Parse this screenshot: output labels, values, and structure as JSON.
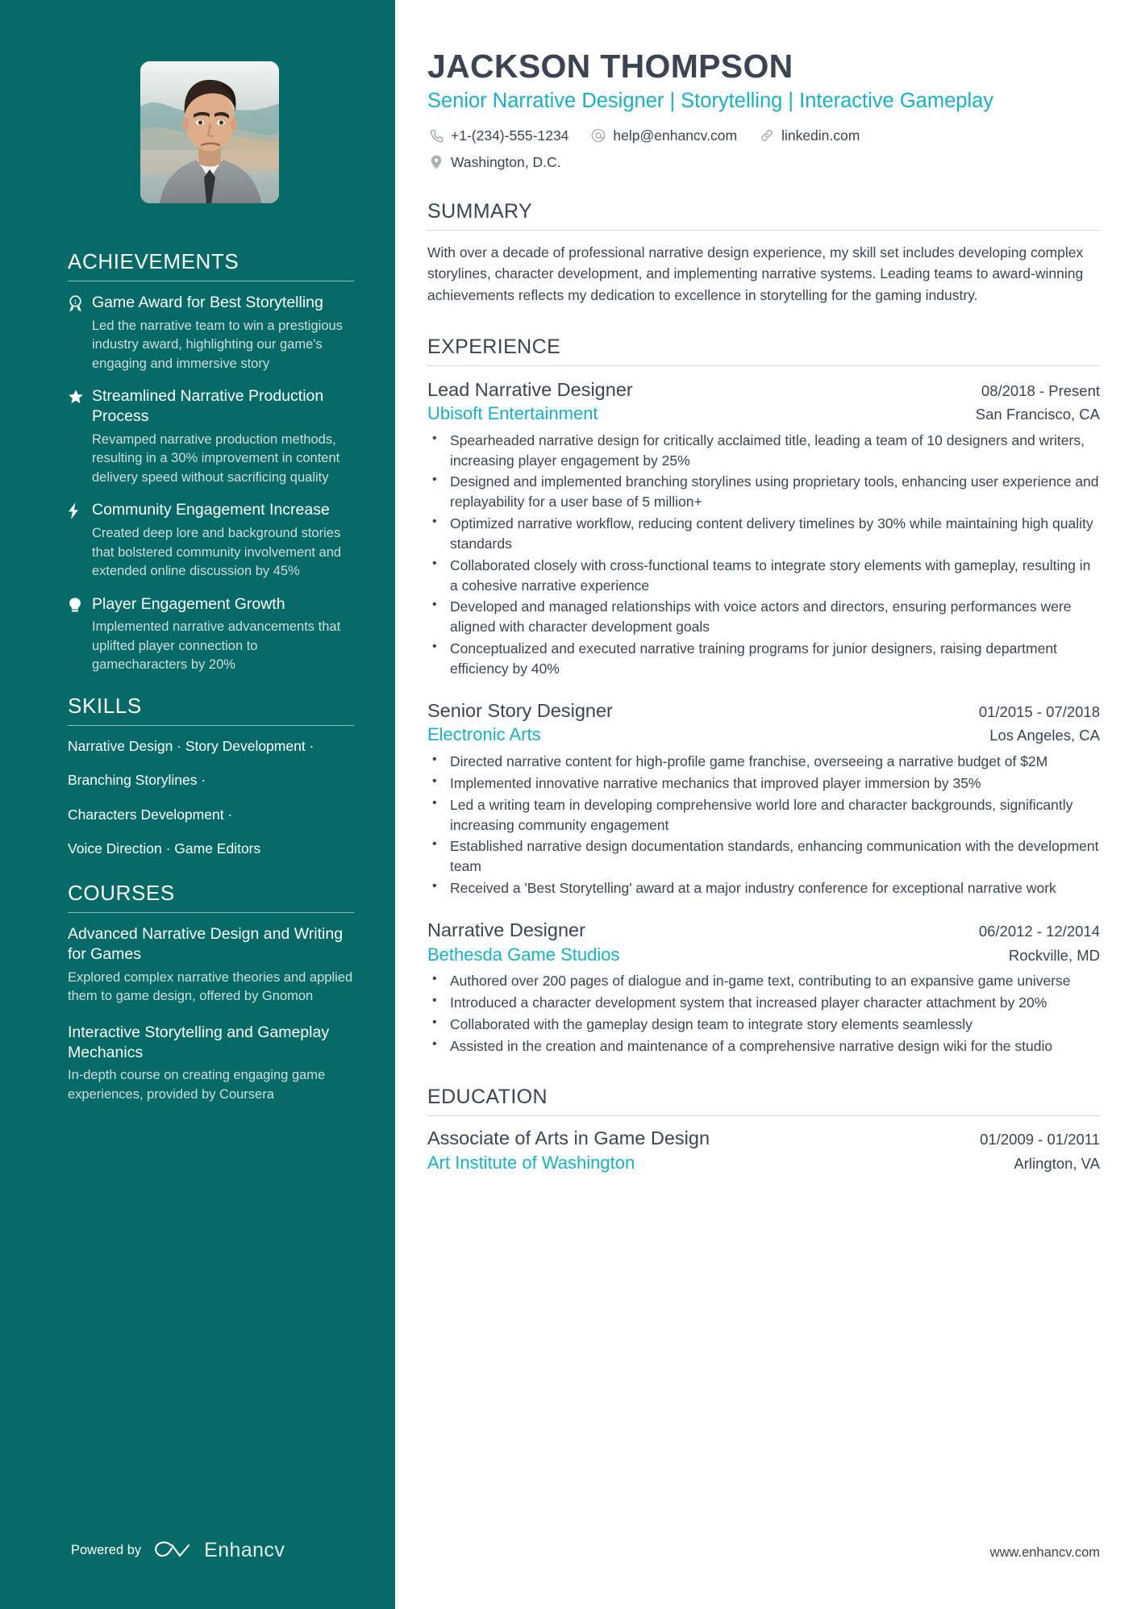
{
  "theme": {
    "sidebar_bg": "#046a68",
    "accent": "#19b0c4",
    "text": "#3d4451",
    "muted_light": "#cfdedd"
  },
  "header": {
    "name": "JACKSON THOMPSON",
    "headline": "Senior Narrative Designer | Storytelling | Interactive Gameplay",
    "contacts": [
      {
        "icon": "phone-icon",
        "value": "+1-(234)-555-1234"
      },
      {
        "icon": "email-icon",
        "value": "help@enhancv.com"
      },
      {
        "icon": "link-icon",
        "value": "linkedin.com"
      },
      {
        "icon": "location-icon",
        "value": "Washington, D.C."
      }
    ]
  },
  "sidebar": {
    "photo_alt": "profile-photo",
    "achievements": {
      "title": "ACHIEVEMENTS",
      "items": [
        {
          "icon": "award-ribbon-icon",
          "title": "Game Award for Best Storytelling",
          "description": "Led the narrative team to win a prestigious industry award, highlighting our game's engaging and immersive story"
        },
        {
          "icon": "star-icon",
          "title": "Streamlined Narrative Production Process",
          "description": "Revamped narrative production methods, resulting in a 30% improvement in content delivery speed without sacrificing quality"
        },
        {
          "icon": "lightning-bolt-icon",
          "title": "Community Engagement Increase",
          "description": "Created deep lore and background stories that bolstered community involvement and extended online discussion by 45%"
        },
        {
          "icon": "lightbulb-icon",
          "title": "Player Engagement Growth",
          "description": "Implemented narrative advancements that uplifted player connection to gamecharacters by 20%"
        }
      ]
    },
    "skills": {
      "title": "SKILLS",
      "lines": [
        "Narrative Design · Story Development ·",
        "Branching Storylines ·",
        "Characters Development ·",
        "Voice Direction · Game Editors"
      ]
    },
    "courses": {
      "title": "COURSES",
      "items": [
        {
          "title": "Advanced Narrative Design and Writing for Games",
          "description": "Explored complex narrative theories and applied them to game design, offered by Gnomon"
        },
        {
          "title": "Interactive Storytelling and Gameplay Mechanics",
          "description": "In-depth course on creating engaging game experiences, provided by Coursera"
        }
      ]
    },
    "footer": {
      "powered_by": "Powered by",
      "brand": "Enhancv",
      "brand_icon": "enhancv-logo-icon"
    }
  },
  "main": {
    "summary": {
      "title": "SUMMARY",
      "text": "With over a decade of professional narrative design experience, my skill set includes developing complex storylines, character development, and implementing narrative systems. Leading teams to award-winning achievements reflects my dedication to excellence in storytelling for the gaming industry."
    },
    "experience": {
      "title": "EXPERIENCE",
      "jobs": [
        {
          "title": "Lead Narrative Designer",
          "dates": "08/2018 - Present",
          "company": "Ubisoft Entertainment",
          "location": "San Francisco, CA",
          "bullets": [
            "Spearheaded narrative design for critically acclaimed title, leading a team of 10 designers and writers, increasing player engagement by 25%",
            "Designed and implemented branching storylines using proprietary tools, enhancing user experience and replayability for a user base of 5 million+",
            "Optimized narrative workflow, reducing content delivery timelines by 30% while maintaining high quality standards",
            "Collaborated closely with cross-functional teams to integrate story elements with gameplay, resulting in a cohesive narrative experience",
            "Developed and managed relationships with voice actors and directors, ensuring performances were aligned with character development goals",
            "Conceptualized and executed narrative training programs for junior designers, raising department efficiency by 40%"
          ]
        },
        {
          "title": "Senior Story Designer",
          "dates": "01/2015 - 07/2018",
          "company": "Electronic Arts",
          "location": "Los Angeles, CA",
          "bullets": [
            "Directed narrative content for high-profile game franchise, overseeing a narrative budget of $2M",
            "Implemented innovative narrative mechanics that improved player immersion by 35%",
            "Led a writing team in developing comprehensive world lore and character backgrounds, significantly increasing community engagement",
            "Established narrative design documentation standards, enhancing communication with the development team",
            "Received a 'Best Storytelling' award at a major industry conference for exceptional narrative work"
          ]
        },
        {
          "title": "Narrative Designer",
          "dates": "06/2012 - 12/2014",
          "company": "Bethesda Game Studios",
          "location": "Rockville, MD",
          "bullets": [
            "Authored over 200 pages of dialogue and in-game text, contributing to an expansive game universe",
            "Introduced a character development system that increased player character attachment by 20%",
            "Collaborated with the gameplay design team to integrate story elements seamlessly",
            "Assisted in the creation and maintenance of a comprehensive narrative design wiki for the studio"
          ]
        }
      ]
    },
    "education": {
      "title": "EDUCATION",
      "entries": [
        {
          "degree": "Associate of Arts in Game Design",
          "dates": "01/2009 - 01/2011",
          "school": "Art Institute of Washington",
          "location": "Arlington, VA"
        }
      ]
    },
    "website": "www.enhancv.com"
  }
}
